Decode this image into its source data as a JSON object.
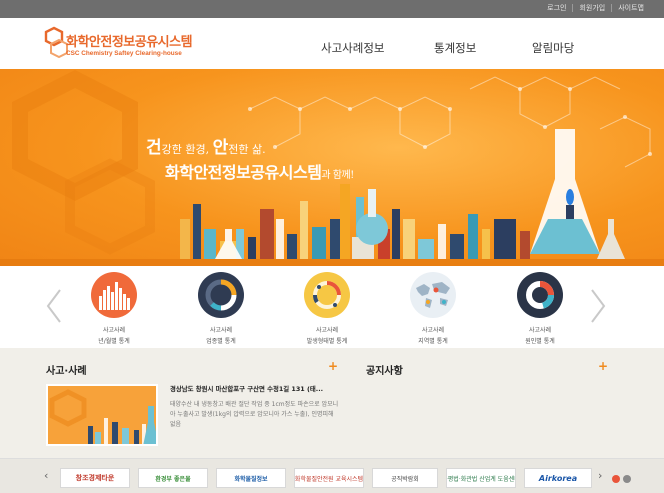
{
  "topbar": {
    "links": [
      "로그인",
      "회원가입",
      "사이트맵"
    ]
  },
  "logo": {
    "title": "화학안전정보공유시스템",
    "subtitle": "CSC Chemistry Saftey Clearing-house"
  },
  "nav": {
    "items": [
      "사고사례정보",
      "통계정보",
      "알림마당"
    ]
  },
  "hero": {
    "line1_a_bold": "건",
    "line1_a_rest": "강한 환경, ",
    "line1_b_bold": "안",
    "line1_b_rest": "전한 삶.",
    "line2_main": "화학안전정보공유시스템",
    "line2_tail": "과 함께!"
  },
  "stats": {
    "items": [
      {
        "line1": "사고사례",
        "line2": "년/월별 통계",
        "icon": "bar-chart-icon"
      },
      {
        "line1": "사고사례",
        "line2": "업종별 통계",
        "icon": "donut-chart-icon"
      },
      {
        "line1": "사고사례",
        "line2": "발생형태별 통계",
        "icon": "pie-ring-icon"
      },
      {
        "line1": "사고사례",
        "line2": "지역별 통계",
        "icon": "world-map-icon"
      },
      {
        "line1": "사고사례",
        "line2": "원인별 통계",
        "icon": "ring-chart-icon"
      }
    ]
  },
  "accidents": {
    "title": "사고·사례",
    "news_title": "경상남도 창원시 마산합포구 구산면 수정1길 131 (태...",
    "news_body": "태양수산 내 냉동창고 배관 절단 작업 중 1cm정도 파손으로 암모니아 누출사고 발생(1kg의 압력으로 암모니아 가스 누출), 인명피해 없음"
  },
  "notices": {
    "title": "공지사항"
  },
  "footer": {
    "banners": [
      "창조경제타운",
      "환경부 좋은물",
      "화학물질정보",
      "화학물질안전원 교육시스템",
      "공직박람회",
      "화평법·화관법 산업계 도움센터",
      "Airkorea"
    ]
  },
  "colors": {
    "accent": "#f08a1e",
    "topbar": "#6e6e6e",
    "content_bg": "#f1efe9"
  }
}
